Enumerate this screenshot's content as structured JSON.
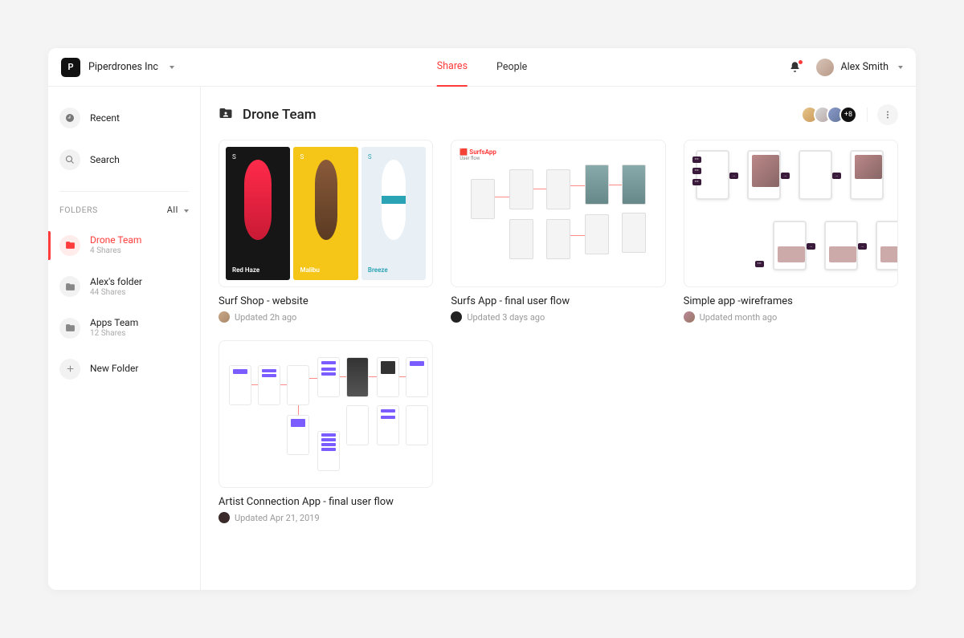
{
  "org": {
    "logo_letter": "P",
    "name": "Piperdrones Inc"
  },
  "nav": {
    "tabs": [
      {
        "label": "Shares",
        "active": true
      },
      {
        "label": "People",
        "active": false
      }
    ]
  },
  "user": {
    "name": "Alex Smith"
  },
  "sidebar": {
    "recent_label": "Recent",
    "search_label": "Search",
    "folders_header": "FOLDERS",
    "filter_label": "All",
    "new_folder_label": "New Folder",
    "folders": [
      {
        "name": "Drone Team",
        "sub": "4 Shares",
        "active": true
      },
      {
        "name": "Alex's folder",
        "sub": "44 Shares",
        "active": false
      },
      {
        "name": "Apps Team",
        "sub": "12 Shares",
        "active": false
      }
    ]
  },
  "main": {
    "title": "Drone Team",
    "extra_members": "+8"
  },
  "thumb1": {
    "panel1_label": "Red Haze",
    "panel2_label": "Malibu",
    "panel3_label": "Breeze",
    "s": "S"
  },
  "thumb2": {
    "logo": "🟥 SurfsApp",
    "sub": "User flow"
  },
  "projects": [
    {
      "title": "Surf Shop - website",
      "meta": "Updated 2h ago"
    },
    {
      "title": "Surfs App - final user flow",
      "meta": "Updated 3 days ago"
    },
    {
      "title": "Simple app -wireframes",
      "meta": "Updated month ago"
    },
    {
      "title": "Artist Connection App - final user flow",
      "meta": "Updated Apr 21, 2019"
    }
  ]
}
